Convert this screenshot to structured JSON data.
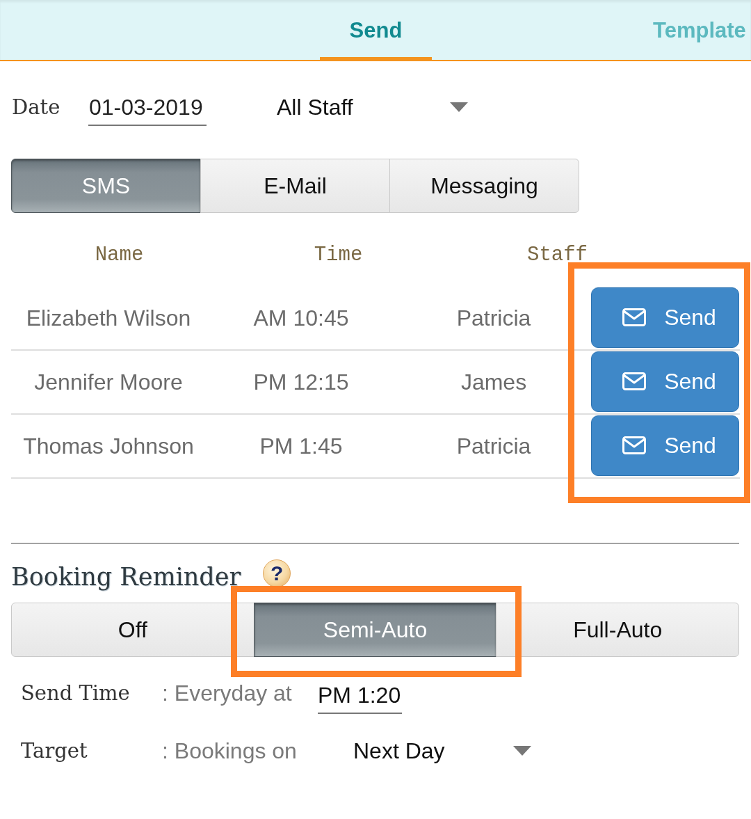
{
  "tabs": [
    {
      "label": "Send",
      "selected": true
    },
    {
      "label": "Template",
      "selected": false
    }
  ],
  "filters": {
    "date_label": "Date",
    "date": "01-03-2019",
    "staff": "All Staff"
  },
  "channels": [
    {
      "label": "SMS",
      "selected": true
    },
    {
      "label": "E-Mail",
      "selected": false
    },
    {
      "label": "Messaging",
      "selected": false
    }
  ],
  "table": {
    "columns": [
      "Name",
      "Time",
      "Staff"
    ],
    "rows": [
      {
        "name": "Elizabeth Wilson",
        "time": "AM 10:45",
        "staff": "Patricia",
        "action": "Send"
      },
      {
        "name": "Jennifer Moore",
        "time": "PM 12:15",
        "staff": "James",
        "action": "Send"
      },
      {
        "name": "Thomas Johnson",
        "time": "PM 1:45",
        "staff": "Patricia",
        "action": "Send"
      }
    ],
    "actions_highlighted": true
  },
  "booking_reminder": {
    "title": "Booking Reminder",
    "help": "?",
    "modes": [
      {
        "label": "Off",
        "selected": false,
        "highlighted": false
      },
      {
        "label": "Semi-Auto",
        "selected": true,
        "highlighted": true
      },
      {
        "label": "Full-Auto",
        "selected": false,
        "highlighted": false
      }
    ],
    "send_time": {
      "label": "Send Time",
      "prefix": ": Everyday at",
      "value": "PM 1:20"
    },
    "target": {
      "label": "Target",
      "prefix": ": Bookings on",
      "value": "Next Day"
    }
  }
}
